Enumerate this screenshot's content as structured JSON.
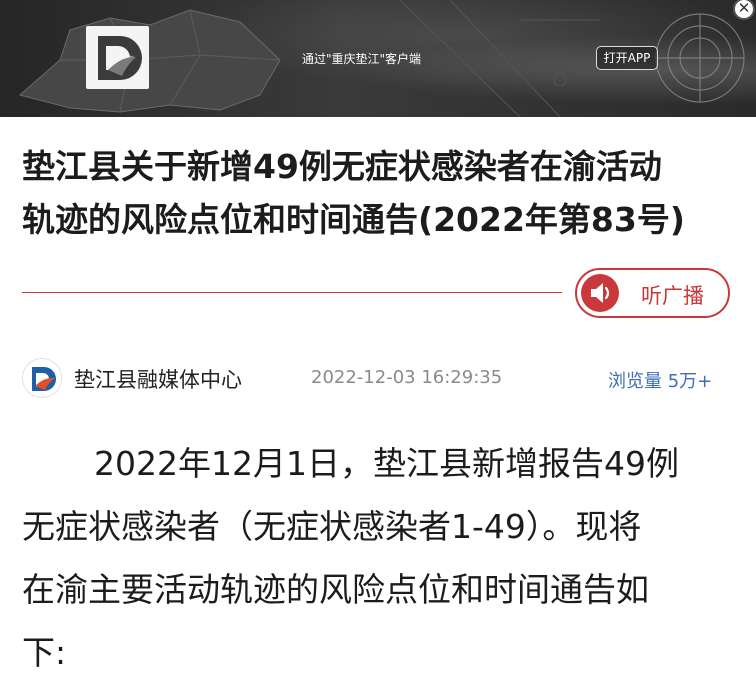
{
  "banner": {
    "promo_text": "通过\"重庆垫江\"客户端",
    "open_app_label": "打开APP",
    "close_glyph": "✕",
    "logo_icon": "dianjiang-app-logo",
    "background_color": "#2b2b2b"
  },
  "article": {
    "title_lines": [
      "垫江县关于新增49例无症状感染者在渝活动",
      "轨迹的风险点位和时间通告(2022年第83号)"
    ],
    "listen_label": "听广播",
    "listen_icon": "speaker-icon",
    "accent_color": "#c9383a",
    "source_name": "垫江县融媒体中心",
    "publish_time": "2022-12-03 16:29:35",
    "views_label": "浏览量",
    "views_count": "5万+",
    "views_color": "#3b6fb6",
    "body_lines": [
      "2022年12月1日，垫江县新增报告49例",
      "无症状感染者（无症状感染者1-49）。现将",
      "在渝主要活动轨迹的风险点位和时间通告如",
      "下:"
    ]
  }
}
